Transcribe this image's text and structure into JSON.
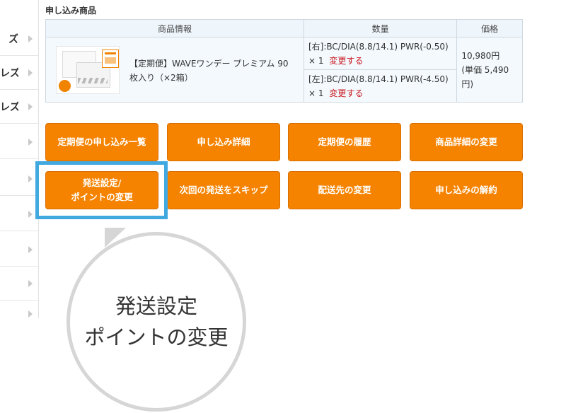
{
  "sidebar": {
    "items": [
      {
        "label": "ズ"
      },
      {
        "label": "レズ"
      },
      {
        "label": "レズ"
      },
      {
        "label": ""
      },
      {
        "label": ""
      },
      {
        "label": ""
      },
      {
        "label": ""
      },
      {
        "label": ""
      },
      {
        "label": ""
      }
    ]
  },
  "section": {
    "title": "申し込み商品"
  },
  "table": {
    "headers": {
      "info": "商品情報",
      "qty": "数量",
      "price": "価格"
    },
    "product": {
      "name_line1": "【定期便】WAVEワンデー プレミアム 90",
      "name_line2": "枚入り（×2箱）",
      "rows": [
        {
          "spec": "[右]:BC/DIA(8.8/14.1) PWR(-0.50)",
          "count": "× 1",
          "change": "変更する"
        },
        {
          "spec": "[左]:BC/DIA(8.8/14.1) PWR(-4.50)",
          "count": "× 1",
          "change": "変更する"
        }
      ],
      "price": "10,980円",
      "unit_price": "(単価 5,490円)"
    }
  },
  "buttons": {
    "subscription_list": "定期便の申し込み一覧",
    "order_detail": "申し込み詳細",
    "subscription_history": "定期便の履歴",
    "change_product_detail": "商品詳細の変更",
    "shipping_settings_line1": "発送設定/",
    "shipping_settings_line2": "ポイントの変更",
    "skip_next": "次回の発送をスキップ",
    "change_address": "配送先の変更",
    "cancel_subscription": "申し込みの解約"
  },
  "callout": {
    "line1": "発送設定",
    "line2": "ポイントの変更"
  },
  "colors": {
    "accent": "#f58300",
    "highlight": "#42a8e0",
    "link": "#c9171e"
  }
}
